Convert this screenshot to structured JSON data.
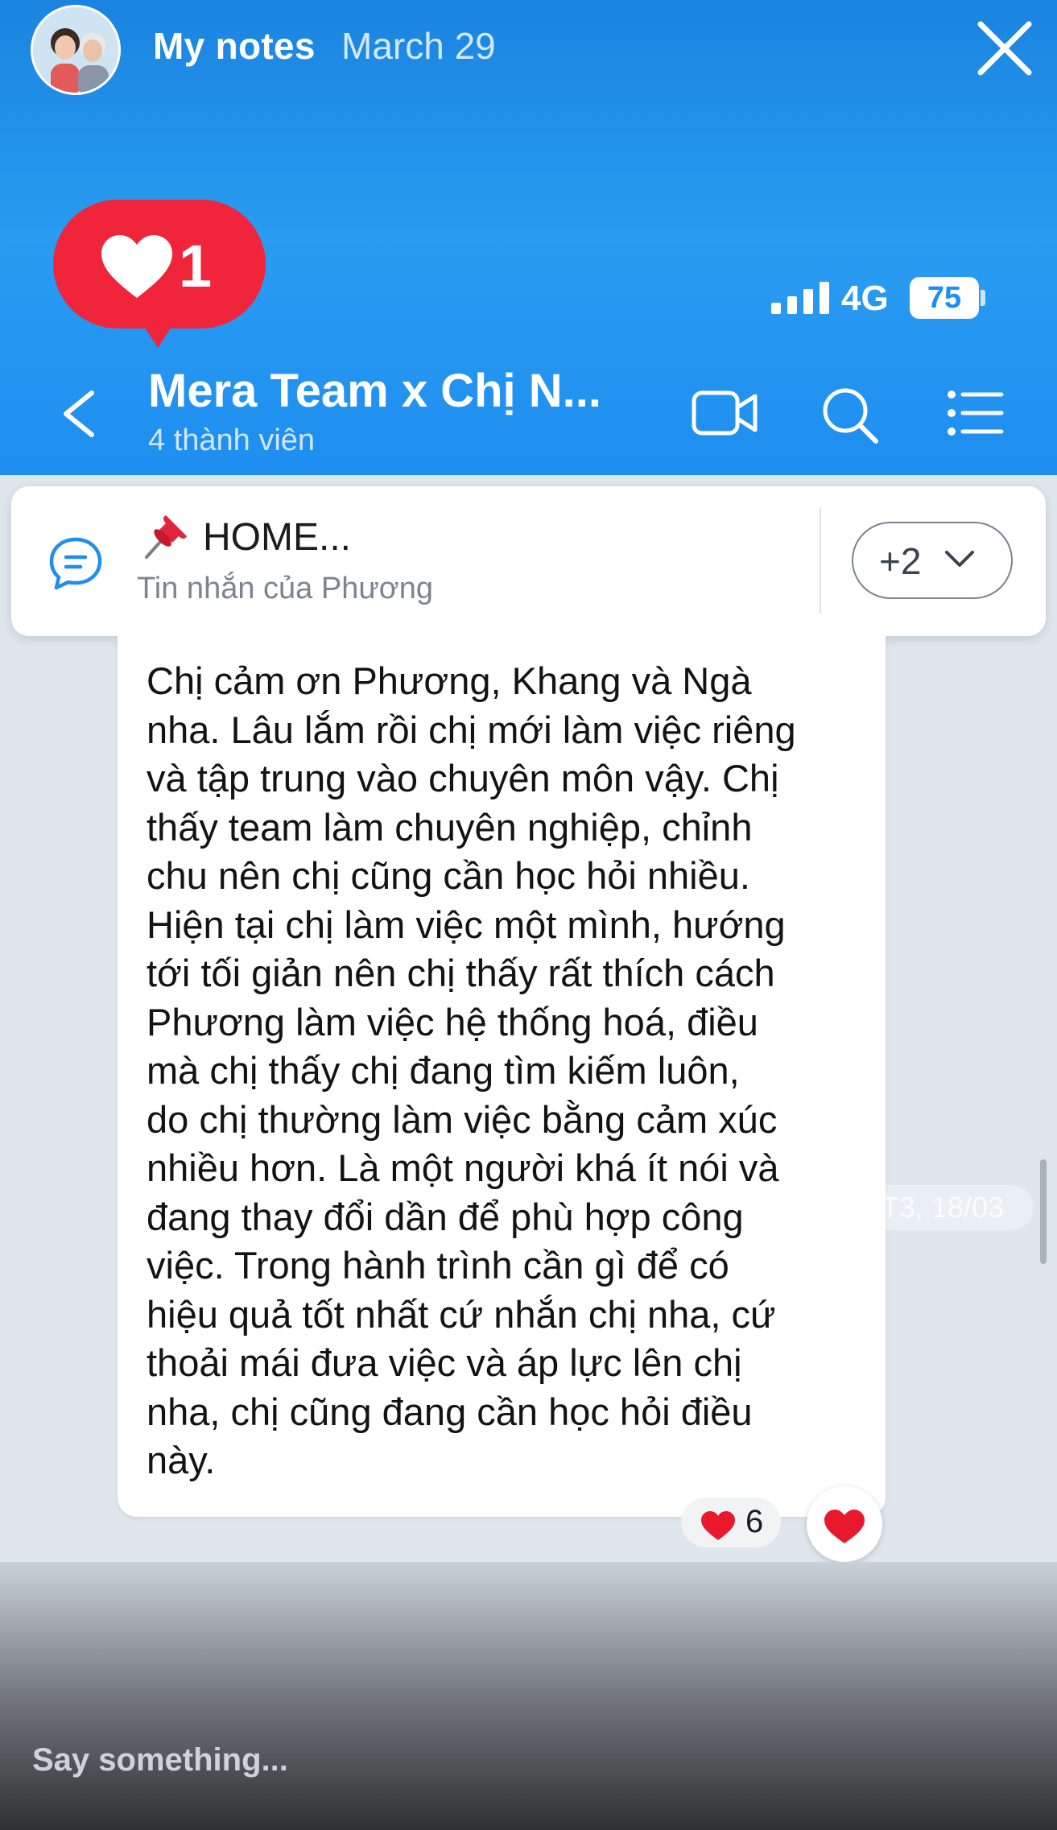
{
  "story": {
    "user": "My notes",
    "date": "March 29",
    "close_icon": "close-icon"
  },
  "status_bar": {
    "network": "4G",
    "battery": "75"
  },
  "like_badge": {
    "icon": "heart-icon",
    "count": "1"
  },
  "header": {
    "title": "Mera Team x Chị N...",
    "subtitle": "4 thành viên",
    "icons": [
      "back-icon",
      "video-call-icon",
      "search-icon",
      "menu-icon"
    ]
  },
  "pinned": {
    "icon": "pin-icon",
    "title": "HOME...",
    "subtitle": "Tin nhắn của Phương",
    "more_label": "+2"
  },
  "message": {
    "text": "Chị cảm ơn Phương, Khang và Ngà\nnha. Lâu lắm rồi chị mới làm việc riêng\nvà tập trung vào chuyên môn vậy. Chị\nthấy team làm chuyên nghiệp, chỉnh\nchu nên chị cũng cần học hỏi nhiều.\nHiện tại chị làm việc một mình, hướng\ntới tối giản nên chị thấy rất thích cách\nPhương làm việc hệ thống hoá, điều\nmà chị thấy chị đang tìm kiếm luôn,\ndo chị thường làm việc bằng cảm xúc\nnhiều hơn. Là một người khá ít nói và\nđang thay đổi dần để phù hợp công\nviệc. Trong hành trình cần gì để có\nhiệu quả tốt nhất cứ nhắn chị nha, cứ\nthoải mái đưa việc và áp lực lên chị\nnha, chị cũng đang cần học hỏi điều\nnày.",
    "timestamp": "T3, 18/03",
    "reaction_count": "6"
  },
  "reply": {
    "placeholder": "Say something..."
  },
  "colors": {
    "brand_blue": "#1e8ef0",
    "like_red": "#f0243a",
    "heart_red": "#e8192c"
  }
}
